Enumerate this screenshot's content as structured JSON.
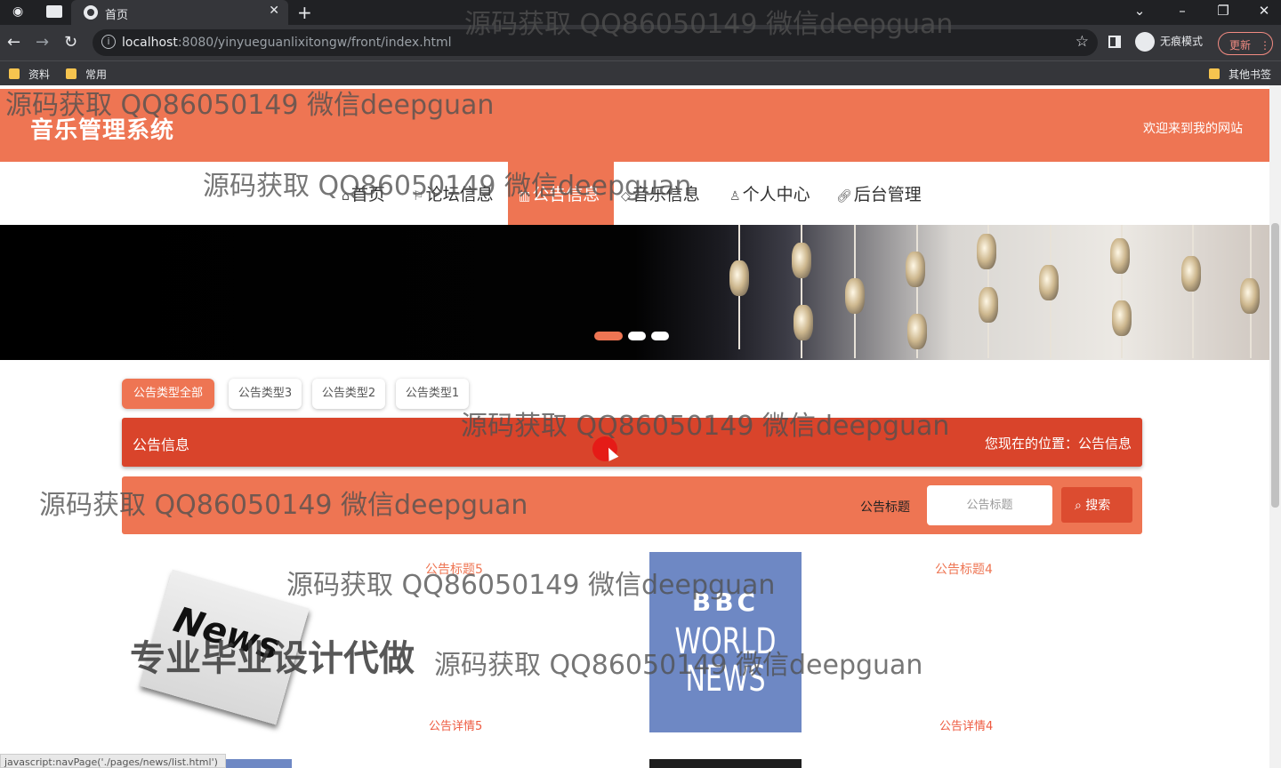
{
  "browser": {
    "tab_title": "首页",
    "url_host": "localhost",
    "url_path": ":8080/yinyueguanlixitongw/front/index.html",
    "incognito_label": "无痕模式",
    "update_label": "更新",
    "bookmarks": [
      "资料",
      "常用"
    ],
    "other_bookmarks": "其他书签"
  },
  "site": {
    "title": "音乐管理系统",
    "welcome": "欢迎来到我的网站"
  },
  "nav": [
    {
      "label": "首页",
      "icon": "home-icon"
    },
    {
      "label": "论坛信息",
      "icon": "flag-icon"
    },
    {
      "label": "公告信息",
      "icon": "news-icon",
      "active": true
    },
    {
      "label": "音乐信息",
      "icon": "tag-icon"
    },
    {
      "label": "个人中心",
      "icon": "user-icon"
    },
    {
      "label": "后台管理",
      "icon": "link-icon"
    }
  ],
  "banner": {
    "slides": 3,
    "active_slide": 1
  },
  "filters": [
    "公告类型全部",
    "公告类型3",
    "公告类型2",
    "公告类型1"
  ],
  "breadcrumb": {
    "section": "公告信息",
    "location": "您现在的位置：公告信息"
  },
  "search": {
    "label": "公告标题",
    "placeholder": "公告标题",
    "button": "搜索"
  },
  "cards": [
    {
      "title": "公告标题5",
      "desc": "公告详情5"
    },
    {
      "title": "公告标题4",
      "desc": "公告详情4"
    }
  ],
  "overlays": {
    "watermark": "源码获取 QQ86050149 微信deepguan",
    "promo": "专业毕业设计代做"
  },
  "status_text": "javascript:navPage('./pages/news/list.html')",
  "colors": {
    "accent": "#ee7553",
    "crumb": "#d9442b",
    "button": "#dc4c30"
  }
}
